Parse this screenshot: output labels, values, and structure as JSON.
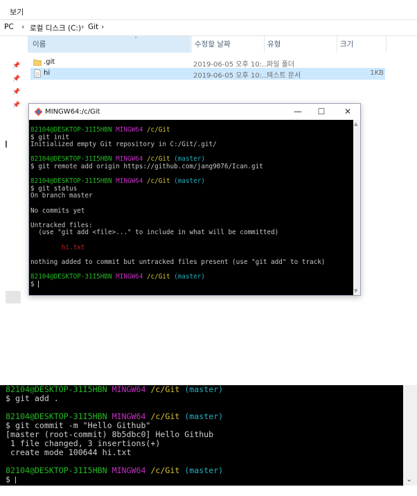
{
  "explorer": {
    "ribbon_label": "보기",
    "breadcrumb": [
      "PC",
      "로컬 디스크 (C:)",
      "Git"
    ],
    "breadcrumb_lead": "ᅵ",
    "columns": {
      "name": "이름",
      "date": "수정한 날짜",
      "type": "유형",
      "size": "크기"
    },
    "files": [
      {
        "name": ".git",
        "date": "2019-06-05 오후 10:...",
        "type": "파일 폴더",
        "size": "",
        "icon": "folder-icon",
        "selected": false
      },
      {
        "name": "hi",
        "date": "2019-06-05 오후 10:...",
        "type": "텍스트 문서",
        "size": "1KB",
        "icon": "text-file-icon",
        "selected": true
      }
    ],
    "accent_selected": "#cce8ff",
    "accent_header": "#d9ebf9"
  },
  "mingw_window": {
    "title": "MINGW64:/c/Git",
    "buttons": {
      "minimize": "—",
      "maximize": "☐",
      "close": "✕"
    },
    "lines": [
      [
        {
          "t": "82104@DESKTOP-31I5HBN",
          "c": "g"
        },
        {
          "t": " "
        },
        {
          "t": "MINGW64",
          "c": "m"
        },
        {
          "t": " "
        },
        {
          "t": "/c/Git",
          "c": "y"
        }
      ],
      [
        {
          "t": "$ git init"
        }
      ],
      [
        {
          "t": "Initialized empty Git repository in C:/Git/.git/"
        }
      ],
      [
        {
          "t": ""
        }
      ],
      [
        {
          "t": "82104@DESKTOP-31I5HBN",
          "c": "g"
        },
        {
          "t": " "
        },
        {
          "t": "MINGW64",
          "c": "m"
        },
        {
          "t": " "
        },
        {
          "t": "/c/Git",
          "c": "y"
        },
        {
          "t": " "
        },
        {
          "t": "(master)",
          "c": "c"
        }
      ],
      [
        {
          "t": "$ git remote add origin https://github.com/jang9076/Ican.git"
        }
      ],
      [
        {
          "t": ""
        }
      ],
      [
        {
          "t": "82104@DESKTOP-31I5HBN",
          "c": "g"
        },
        {
          "t": " "
        },
        {
          "t": "MINGW64",
          "c": "m"
        },
        {
          "t": " "
        },
        {
          "t": "/c/Git",
          "c": "y"
        },
        {
          "t": " "
        },
        {
          "t": "(master)",
          "c": "c"
        }
      ],
      [
        {
          "t": "$ git status"
        }
      ],
      [
        {
          "t": "On branch master"
        }
      ],
      [
        {
          "t": ""
        }
      ],
      [
        {
          "t": "No commits yet"
        }
      ],
      [
        {
          "t": ""
        }
      ],
      [
        {
          "t": "Untracked files:"
        }
      ],
      [
        {
          "t": "  (use \"git add <file>...\" to include in what will be committed)"
        }
      ],
      [
        {
          "t": ""
        }
      ],
      [
        {
          "t": "        "
        },
        {
          "t": "hi.txt",
          "c": "r"
        }
      ],
      [
        {
          "t": ""
        }
      ],
      [
        {
          "t": "nothing added to commit but untracked files present (use \"git add\" to track)"
        }
      ],
      [
        {
          "t": ""
        }
      ],
      [
        {
          "t": "82104@DESKTOP-31I5HBN",
          "c": "g"
        },
        {
          "t": " "
        },
        {
          "t": "MINGW64",
          "c": "m"
        },
        {
          "t": " "
        },
        {
          "t": "/c/Git",
          "c": "y"
        },
        {
          "t": " "
        },
        {
          "t": "(master)",
          "c": "c"
        }
      ],
      [
        {
          "t": "$ "
        }
      ]
    ]
  },
  "bottom_terminal": {
    "lines": [
      [
        {
          "t": "82104@DESKTOP-31I5HBN",
          "c": "g"
        },
        {
          "t": " "
        },
        {
          "t": "MINGW64",
          "c": "m"
        },
        {
          "t": " "
        },
        {
          "t": "/c/Git",
          "c": "y"
        },
        {
          "t": " "
        },
        {
          "t": "(master)",
          "c": "c"
        }
      ],
      [
        {
          "t": "$ git add ."
        }
      ],
      [
        {
          "t": ""
        }
      ],
      [
        {
          "t": "82104@DESKTOP-31I5HBN",
          "c": "g"
        },
        {
          "t": " "
        },
        {
          "t": "MINGW64",
          "c": "m"
        },
        {
          "t": " "
        },
        {
          "t": "/c/Git",
          "c": "y"
        },
        {
          "t": " "
        },
        {
          "t": "(master)",
          "c": "c"
        }
      ],
      [
        {
          "t": "$ git commit -m \"Hello Github\""
        }
      ],
      [
        {
          "t": "[master (root-commit) 8b5dbc0] Hello Github"
        }
      ],
      [
        {
          "t": " 1 file changed, 3 insertions(+)"
        }
      ],
      [
        {
          "t": " create mode 100644 hi.txt"
        }
      ],
      [
        {
          "t": ""
        }
      ],
      [
        {
          "t": "82104@DESKTOP-31I5HBN",
          "c": "g"
        },
        {
          "t": " "
        },
        {
          "t": "MINGW64",
          "c": "m"
        },
        {
          "t": " "
        },
        {
          "t": "/c/Git",
          "c": "y"
        },
        {
          "t": " "
        },
        {
          "t": "(master)",
          "c": "c"
        }
      ],
      [
        {
          "t": "$ "
        }
      ]
    ]
  },
  "colors": {
    "prompt_user": "#25bc24",
    "prompt_host": "#c030c0",
    "prompt_path": "#d8c436",
    "prompt_branch": "#25b0c0",
    "untracked_file": "#c02020"
  }
}
